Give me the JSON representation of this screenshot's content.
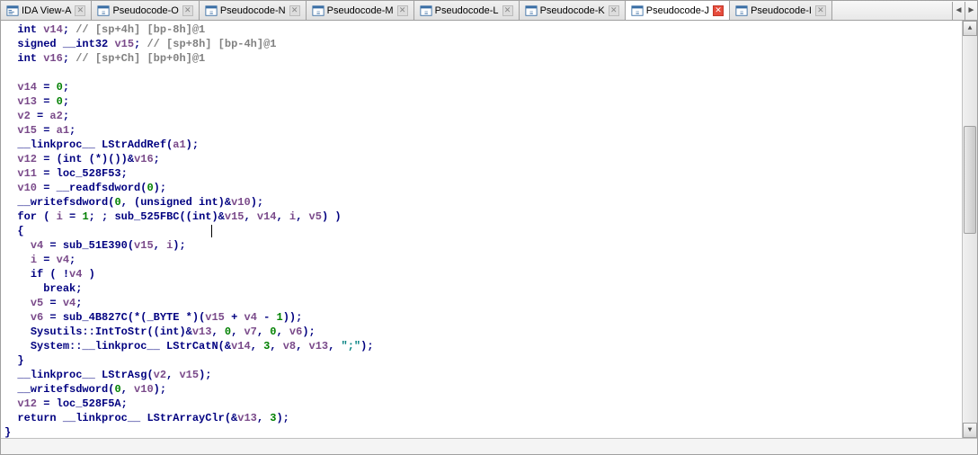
{
  "tabs": [
    {
      "label": "IDA View-A",
      "icon": "ida",
      "active": false,
      "closeRed": false
    },
    {
      "label": "Pseudocode-O",
      "icon": "pseudo",
      "active": false,
      "closeRed": false
    },
    {
      "label": "Pseudocode-N",
      "icon": "pseudo",
      "active": false,
      "closeRed": false
    },
    {
      "label": "Pseudocode-M",
      "icon": "pseudo",
      "active": false,
      "closeRed": false
    },
    {
      "label": "Pseudocode-L",
      "icon": "pseudo",
      "active": false,
      "closeRed": false
    },
    {
      "label": "Pseudocode-K",
      "icon": "pseudo",
      "active": false,
      "closeRed": false
    },
    {
      "label": "Pseudocode-J",
      "icon": "pseudo",
      "active": true,
      "closeRed": true
    },
    {
      "label": "Pseudocode-I",
      "icon": "pseudo",
      "active": false,
      "closeRed": false
    }
  ],
  "code": {
    "l01_decl": {
      "type": "int",
      "name": "v14",
      "cm": "// [sp+4h] [bp-8h]@1"
    },
    "l02_decl": {
      "type": "signed __int32",
      "name": "v15",
      "cm": "// [sp+8h] [bp-4h]@1"
    },
    "l03_decl": {
      "type": "int",
      "name": "v16",
      "cm": "// [sp+Ch] [bp+0h]@1"
    },
    "l05": {
      "lhs": "v14",
      "rhs": "0"
    },
    "l06": {
      "lhs": "v13",
      "rhs": "0"
    },
    "l07": {
      "lhs": "v2",
      "rhs": "a2"
    },
    "l08": {
      "lhs": "v15",
      "rhs": "a1"
    },
    "l09_fn": "__linkproc__ LStrAddRef",
    "l09_arg": "a1",
    "l10": {
      "lhs": "v12",
      "cast1": "int",
      "cast2": "*",
      "rhs": "v16"
    },
    "l11": {
      "lhs": "v11",
      "rhs": "loc_528F53"
    },
    "l12": {
      "lhs": "v10",
      "fn": "__readfsdword",
      "arg": "0"
    },
    "l13_fn": "__writefsdword",
    "l13_a0": "0",
    "l13_cast": "unsigned int",
    "l13_a1": "v10",
    "l14_kw": "for",
    "l14_i": "i",
    "l14_init": "1",
    "l14_fn": "sub_525FBC",
    "l14_cast": "int",
    "l14_a0": "v15",
    "l14_a1": "v14",
    "l14_a2": "i",
    "l14_a3": "v5",
    "l16": {
      "lhs": "v4",
      "fn": "sub_51E390",
      "a0": "v15",
      "a1": "i"
    },
    "l17": {
      "lhs": "i",
      "rhs": "v4"
    },
    "l18_kw": "if",
    "l18_cond": "v4",
    "l19_kw": "break",
    "l20": {
      "lhs": "v5",
      "rhs": "v4"
    },
    "l21": {
      "lhs": "v6",
      "fn": "sub_4B827C",
      "inner_cast": "_BYTE",
      "a0": "v15",
      "a1": "v4",
      "a2": "1"
    },
    "l22_fn": "Sysutils::IntToStr",
    "l22_cast": "int",
    "l22_a0": "v13",
    "l22_a1": "0",
    "l22_a2": "v7",
    "l22_a3": "0",
    "l22_a4": "v6",
    "l23_fn": "System::__linkproc__ LStrCatN",
    "l23_a0": "v14",
    "l23_a1": "3",
    "l23_a2": "v8",
    "l23_a3": "v13",
    "l23_s": "\";\"",
    "l25_fn": "__linkproc__ LStrAsg",
    "l25_a0": "v2",
    "l25_a1": "v15",
    "l26_fn": "__writefsdword",
    "l26_a0": "0",
    "l26_a1": "v10",
    "l27": {
      "lhs": "v12",
      "rhs": "loc_528F5A"
    },
    "l28_kw": "return",
    "l28_fn": "__linkproc__ LStrArrayClr",
    "l28_a0": "v13",
    "l28_a1": "3"
  },
  "status": ""
}
